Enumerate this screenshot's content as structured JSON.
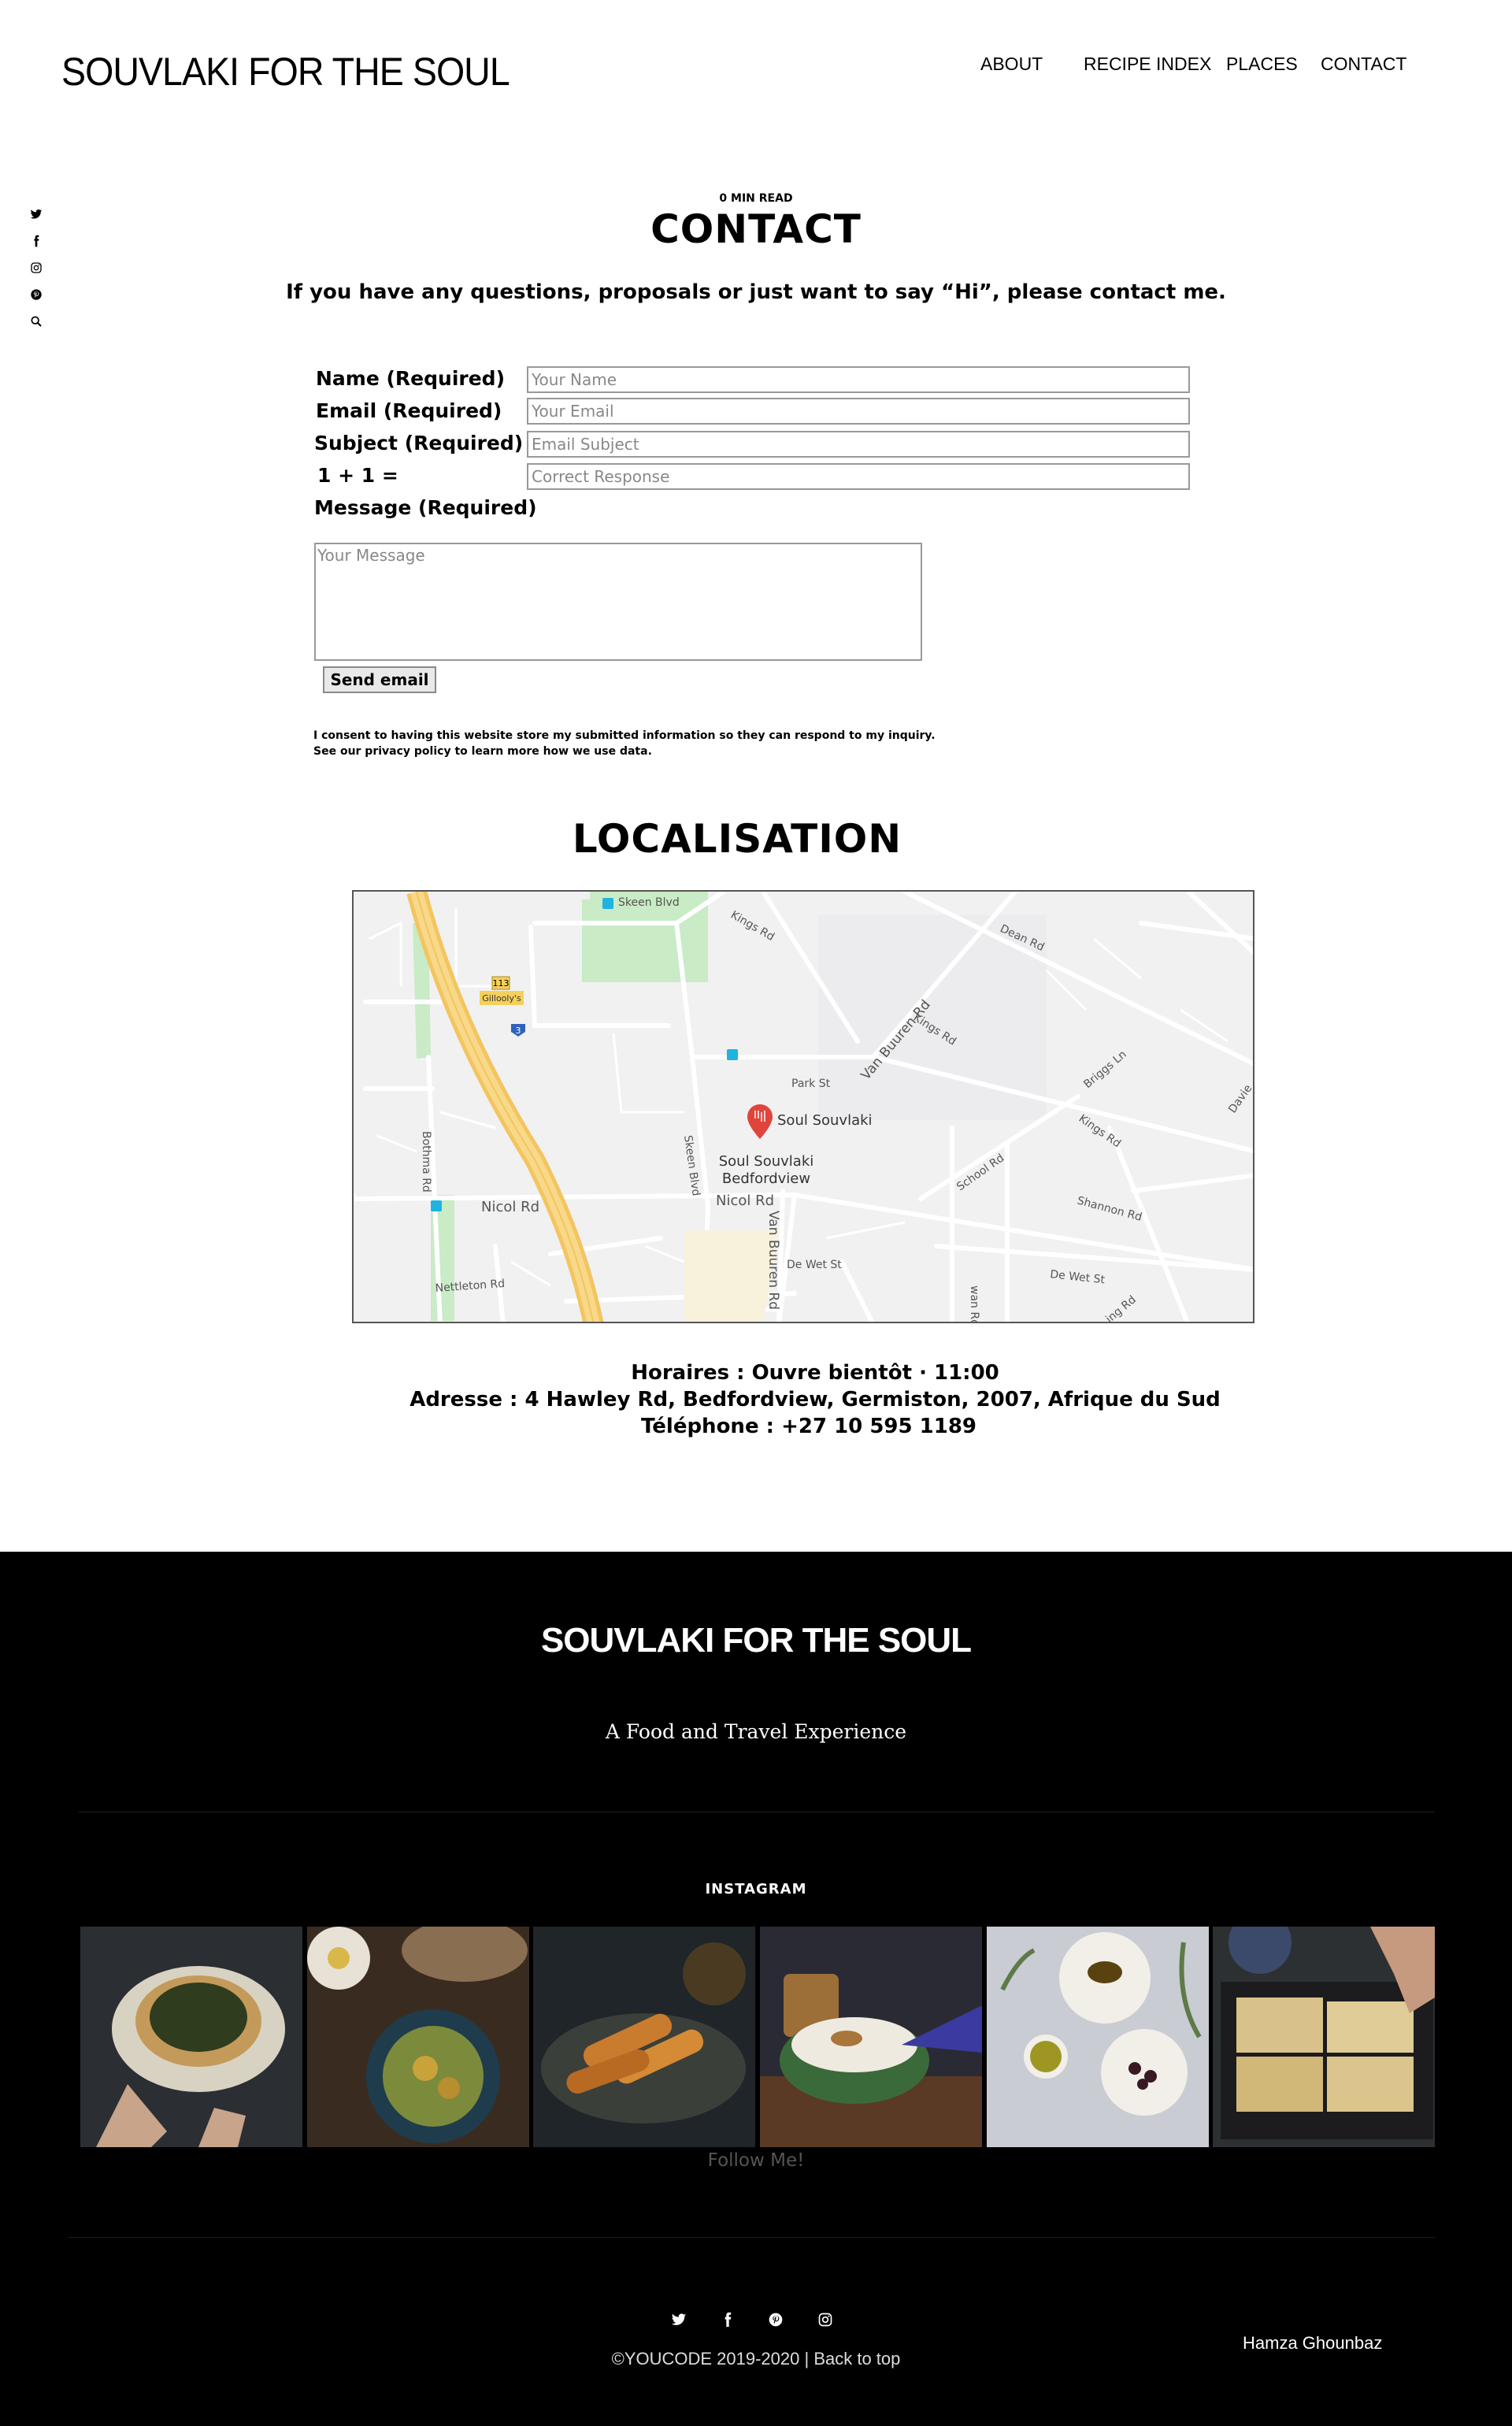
{
  "header": {
    "brand": "SOUVLAKI FOR THE SOUL",
    "nav": [
      "ABOUT",
      "RECIPE INDEX",
      "PLACES",
      "CONTACT"
    ]
  },
  "social_sidebar": [
    "twitter-icon",
    "facebook-icon",
    "instagram-icon",
    "pinterest-icon",
    "search-icon"
  ],
  "contact": {
    "read_time": "0 MIN READ",
    "title": "CONTACT",
    "intro": "If you have any questions, proposals or just want to say “Hi”, please contact me.",
    "fields": [
      {
        "label": "Name (Required)",
        "placeholder": "Your Name"
      },
      {
        "label": "Email (Required)",
        "placeholder": "Your Email"
      },
      {
        "label": "Subject (Required)",
        "placeholder": "Email Subject"
      },
      {
        "label": "1 + 1 =",
        "placeholder": "Correct Response"
      }
    ],
    "message_label": "Message (Required)",
    "message_placeholder": "Your Message",
    "send_label": "Send email",
    "consent_line1": "I consent to having this website store my submitted information so they can respond to my inquiry.",
    "consent_line2": "See our privacy policy to learn more how we use data."
  },
  "localisation": {
    "title": "LOCALISATION",
    "map_labels": {
      "skeen_blvd_top": "Skeen Blvd",
      "kings_rd_1": "Kings Rd",
      "dean_rd": "Dean Rd",
      "kings_rd_2": "Kings Rd",
      "van_buuren_rd": "Van Buuren Rd",
      "park_st": "Park St",
      "briggs_ln": "Briggs Ln",
      "kings_rd_3": "Kings Rd",
      "davie": "Davie",
      "route_113": "113",
      "gilloolys": "Gillooly's",
      "route_3": "3",
      "place_name": "Soul Souvlaki",
      "place_sub1": "Soul Souvlaki",
      "place_sub2": "Bedfordview",
      "bothma_rd": "Bothma Rd",
      "skeen_blvd_side": "Skeen Blvd",
      "nicol_rd_1": "Nicol Rd",
      "nicol_rd_2": "Nicol Rd",
      "school_rd": "School Rd",
      "shannon_rd": "Shannon Rd",
      "van_buuren_rd_2": "Van Buuren Rd",
      "de_wet_st_1": "De Wet St",
      "de_wet_st_2": "De Wet St",
      "nettleton_rd": "Nettleton Rd",
      "wan_rd": "wan Rd",
      "ing_rd": "ing Rd"
    },
    "hours": "Horaires : Ouvre bientôt · 11:00",
    "address": "Adresse : 4 Hawley Rd, Bedfordview, Germiston, 2007, Afrique du Sud",
    "phone": "Téléphone : +27 10 595 1189"
  },
  "footer": {
    "brand": "SOUVLAKI FOR THE SOUL",
    "tagline": "A Food and Travel Experience",
    "instagram_title": "INSTAGRAM",
    "follow": "Follow Me!",
    "social": [
      "twitter-icon",
      "facebook-icon",
      "pinterest-icon",
      "instagram-icon"
    ],
    "copyright": "©YOUCODE 2019-2020 | Back to top",
    "author": "Hamza Ghounbaz"
  },
  "colors": {
    "footer_bg": "#000000",
    "map_bg": "#f1f1f2",
    "highway": "#f8d776",
    "pin": "#e0443b",
    "park": "#b8e3b5"
  }
}
